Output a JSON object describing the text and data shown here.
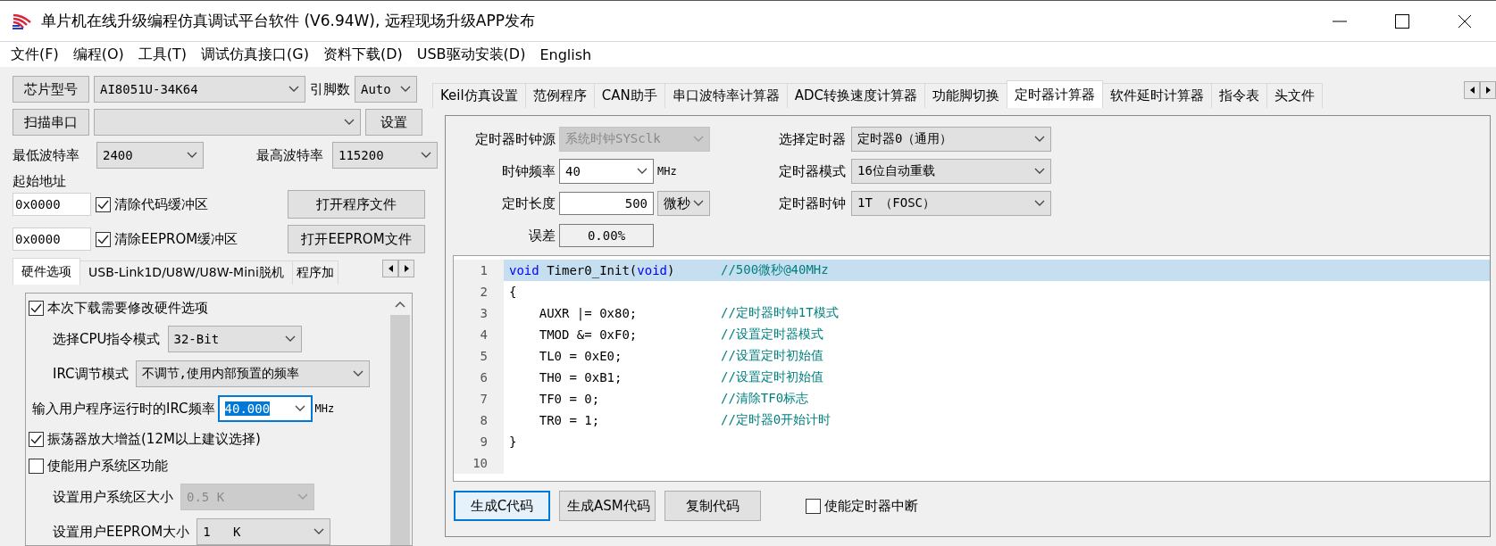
{
  "window": {
    "title": "单片机在线升级编程仿真调试平台软件 (V6.94W), 远程现场升级APP发布"
  },
  "menu": [
    "文件(F)",
    "编程(O)",
    "工具(T)",
    "调试仿真接口(G)",
    "资料下载(D)",
    "USB驱动安装(D)",
    "English"
  ],
  "chip": {
    "button": "芯片型号",
    "value": "AI8051U-34K64",
    "pins_label": "引脚数",
    "pins_value": "Auto"
  },
  "port": {
    "button": "扫描串口",
    "settings_button": "设置"
  },
  "baud": {
    "min_label": "最低波特率",
    "min_value": "2400",
    "max_label": "最高波特率",
    "max_value": "115200"
  },
  "start_address": {
    "label": "起始地址",
    "rows": [
      {
        "address": "0x0000",
        "checkbox": "清除代码缓冲区",
        "checked": true,
        "button": "打开程序文件"
      },
      {
        "address": "0x0000",
        "checkbox": "清除EEPROM缓冲区",
        "checked": true,
        "button": "打开EEPROM文件"
      }
    ]
  },
  "left_tabs": [
    {
      "label": "硬件选项",
      "selected": true
    },
    {
      "label": "USB-Link1D/U8W/U8W-Mini脱机",
      "selected": false
    },
    {
      "label": "程序加",
      "selected": false
    }
  ],
  "hardware_options": [
    {
      "kind": "checkbox",
      "label": "本次下载需要修改硬件选项",
      "checked": true
    },
    {
      "kind": "select",
      "label": "选择CPU指令模式",
      "value": "32-Bit",
      "disabled": false
    },
    {
      "kind": "select",
      "label": "IRC调节模式",
      "value": "不调节,使用内部预置的频率",
      "disabled": false
    },
    {
      "kind": "combo",
      "label": "输入用户程序运行时的IRC频率",
      "value": "40.000",
      "unit": "MHz",
      "focused": true
    },
    {
      "kind": "checkbox",
      "label": "振荡器放大增益(12M以上建议选择)",
      "checked": true
    },
    {
      "kind": "checkbox",
      "label": "使能用户系统区功能",
      "checked": false
    },
    {
      "kind": "select",
      "label": "设置用户系统区大小",
      "value": "0.5 K",
      "disabled": true
    },
    {
      "kind": "select",
      "label": "设置用户EEPROM大小",
      "value": "1   K",
      "disabled": false
    }
  ],
  "right_tabs": [
    {
      "label": "Keil仿真设置",
      "selected": false
    },
    {
      "label": "范例程序",
      "selected": false
    },
    {
      "label": "CAN助手",
      "selected": false
    },
    {
      "label": "串口波特率计算器",
      "selected": false
    },
    {
      "label": "ADC转换速度计算器",
      "selected": false
    },
    {
      "label": "功能脚切换",
      "selected": false
    },
    {
      "label": "定时器计算器",
      "selected": true
    },
    {
      "label": "软件延时计算器",
      "selected": false
    },
    {
      "label": "指令表",
      "selected": false
    },
    {
      "label": "头文件",
      "selected": false
    }
  ],
  "timer_form": {
    "left": [
      {
        "kind": "select",
        "label": "定时器时钟源",
        "value": "系统时钟SYSclk",
        "disabled": true
      },
      {
        "kind": "combo",
        "label": "时钟频率",
        "value": "40",
        "unit": "MHz"
      },
      {
        "kind": "number",
        "label": "定时长度",
        "value": "500",
        "unit": "微秒"
      },
      {
        "kind": "readout",
        "label": "误差",
        "value": "0.00%"
      }
    ],
    "right": [
      {
        "label": "选择定时器",
        "value": "定时器0（通用）"
      },
      {
        "label": "定时器模式",
        "value": "16位自动重载"
      },
      {
        "label": "定时器时钟",
        "value": "1T （FOSC）"
      }
    ]
  },
  "code": [
    {
      "number": "1",
      "selected": true,
      "segments": [
        {
          "kind": "keyword",
          "text": "void"
        },
        {
          "kind": "plain",
          "text": " Timer0_Init("
        },
        {
          "kind": "keyword",
          "text": "void"
        },
        {
          "kind": "plain",
          "text": ")"
        }
      ],
      "comment": "//500微秒@40MHz"
    },
    {
      "number": "2",
      "selected": false,
      "segments": [
        {
          "kind": "plain",
          "text": "{"
        }
      ]
    },
    {
      "number": "3",
      "selected": false,
      "segments": [
        {
          "kind": "plain",
          "text": "    AUXR |= 0x80;"
        }
      ],
      "comment": "//定时器时钟1T模式"
    },
    {
      "number": "4",
      "selected": false,
      "segments": [
        {
          "kind": "plain",
          "text": "    TMOD &= 0xF0;"
        }
      ],
      "comment": "//设置定时器模式"
    },
    {
      "number": "5",
      "selected": false,
      "segments": [
        {
          "kind": "plain",
          "text": "    TL0 = 0xE0;"
        }
      ],
      "comment": "//设置定时初始值"
    },
    {
      "number": "6",
      "selected": false,
      "segments": [
        {
          "kind": "plain",
          "text": "    TH0 = 0xB1;"
        }
      ],
      "comment": "//设置定时初始值"
    },
    {
      "number": "7",
      "selected": false,
      "segments": [
        {
          "kind": "plain",
          "text": "    TF0 = 0;"
        }
      ],
      "comment": "//清除TF0标志"
    },
    {
      "number": "8",
      "selected": false,
      "segments": [
        {
          "kind": "plain",
          "text": "    TR0 = 1;"
        }
      ],
      "comment": "//定时器0开始计时"
    },
    {
      "number": "9",
      "selected": false,
      "segments": [
        {
          "kind": "plain",
          "text": "}"
        }
      ]
    },
    {
      "number": "10",
      "selected": false
    }
  ],
  "actions": [
    {
      "label": "生成C代码",
      "focused": true
    },
    {
      "label": "生成ASM代码",
      "focused": false
    },
    {
      "label": "复制代码",
      "focused": false
    }
  ],
  "interrupt": {
    "label": "使能定时器中断",
    "checked": false
  }
}
